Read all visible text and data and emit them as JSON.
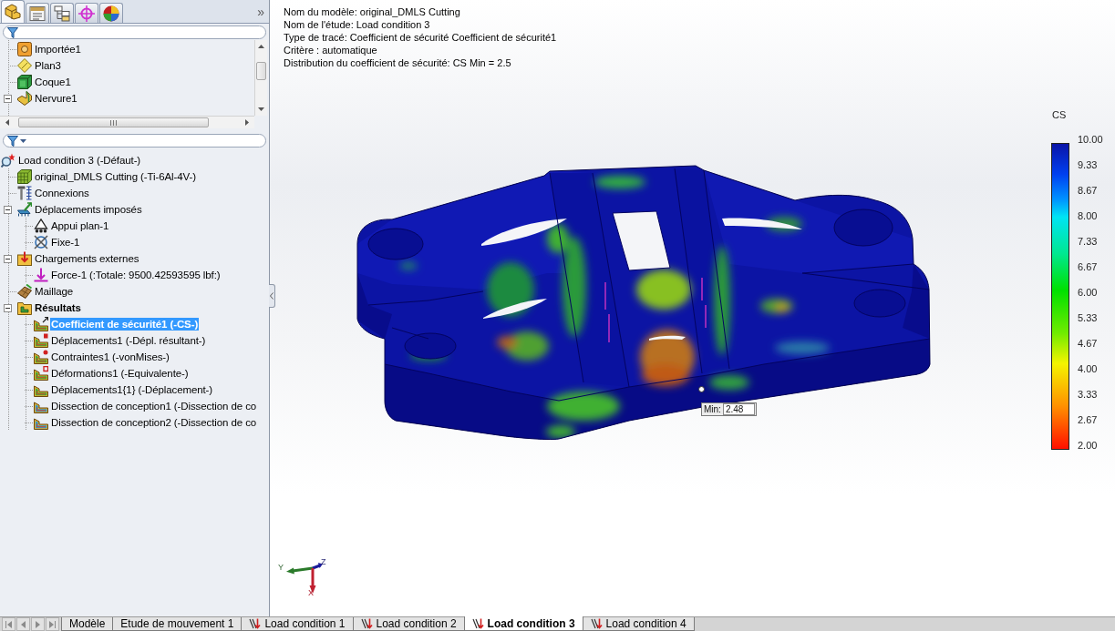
{
  "panel_tabs": [
    {
      "kind": "features",
      "selected": true
    },
    {
      "kind": "properties",
      "selected": false
    },
    {
      "kind": "configurations",
      "selected": false
    },
    {
      "kind": "dimxpert",
      "selected": false
    },
    {
      "kind": "display",
      "selected": false
    }
  ],
  "panel_more": "»",
  "feature_tree": [
    {
      "label": "Importée1",
      "kind": "imported",
      "selected": false
    },
    {
      "label": "Plan3",
      "kind": "plane",
      "selected": false
    },
    {
      "label": "Coque1",
      "kind": "shell",
      "selected": false
    },
    {
      "label": "Nervure1",
      "kind": "rib",
      "selected": false,
      "expanded": true
    }
  ],
  "study_tree": [
    {
      "label": "Load condition 3 (-Défaut-)",
      "kind": "study",
      "selected": false,
      "children": [
        {
          "label": "original_DMLS Cutting (-Ti-6Al-4V-)",
          "kind": "part",
          "selected": false
        },
        {
          "label": "Connexions",
          "kind": "connections",
          "selected": false
        },
        {
          "label": "Déplacements imposés",
          "kind": "fixtures",
          "selected": false,
          "expanded": true,
          "children": [
            {
              "label": "Appui plan-1",
              "kind": "roller",
              "selected": false
            },
            {
              "label": "Fixe-1",
              "kind": "fixed",
              "selected": false
            }
          ]
        },
        {
          "label": "Chargements externes",
          "kind": "loads",
          "selected": false,
          "expanded": true,
          "children": [
            {
              "label": "Force-1 (:Totale: 9500.42593595 lbf:)",
              "kind": "force",
              "selected": false
            }
          ]
        },
        {
          "label": "Maillage",
          "kind": "mesh",
          "selected": false
        },
        {
          "label": "Résultats",
          "kind": "results",
          "selected": false,
          "expanded": true,
          "children": [
            {
              "label": "Coefficient de sécurité1 (-CS-)",
              "kind": "safety",
              "selected": true
            },
            {
              "label": "Déplacements1 (-Dépl. résultant-)",
              "kind": "displacement",
              "selected": false
            },
            {
              "label": "Contraintes1 (-vonMises-)",
              "kind": "stress",
              "selected": false
            },
            {
              "label": "Déformations1 (-Equivalente-)",
              "kind": "strain",
              "selected": false
            },
            {
              "label": "Déplacements1{1} (-Déplacement-)",
              "kind": "plot",
              "selected": false
            },
            {
              "label": "Dissection de conception1 (-Dissection de co",
              "kind": "design",
              "selected": false
            },
            {
              "label": "Dissection de conception2 (-Dissection de co",
              "kind": "design",
              "selected": false
            }
          ]
        }
      ]
    }
  ],
  "plot_info": [
    "Nom du modèle: original_DMLS Cutting",
    "Nom de l'étude: Load condition 3",
    "Type de tracé: Coefficient de sécurité Coefficient de sécurité1",
    "Critère : automatique",
    "Distribution du coefficient de sécurité: CS Min = 2.5"
  ],
  "legend": {
    "title": "CS",
    "labels": [
      "10.00",
      "9.33",
      "8.67",
      "8.00",
      "7.33",
      "6.67",
      "6.00",
      "5.33",
      "4.67",
      "4.00",
      "3.33",
      "2.67",
      "2.00"
    ]
  },
  "min_probe": {
    "label": "Min:",
    "value": "2.48"
  },
  "axes": [
    {
      "kind": "y",
      "label": "Y"
    },
    {
      "kind": "z",
      "label": "Z"
    },
    {
      "kind": "x",
      "label": "X"
    }
  ],
  "bottom_tabs": [
    {
      "label": "Modèle",
      "kind": "model",
      "selected": false
    },
    {
      "label": "Etude de mouvement 1",
      "kind": "motion",
      "selected": false
    },
    {
      "label": "Load condition 1",
      "kind": "simulation",
      "selected": false
    },
    {
      "label": "Load condition 2",
      "kind": "simulation",
      "selected": false
    },
    {
      "label": "Load condition 3",
      "kind": "simulation",
      "selected": true
    },
    {
      "label": "Load condition 4",
      "kind": "simulation",
      "selected": false
    }
  ]
}
